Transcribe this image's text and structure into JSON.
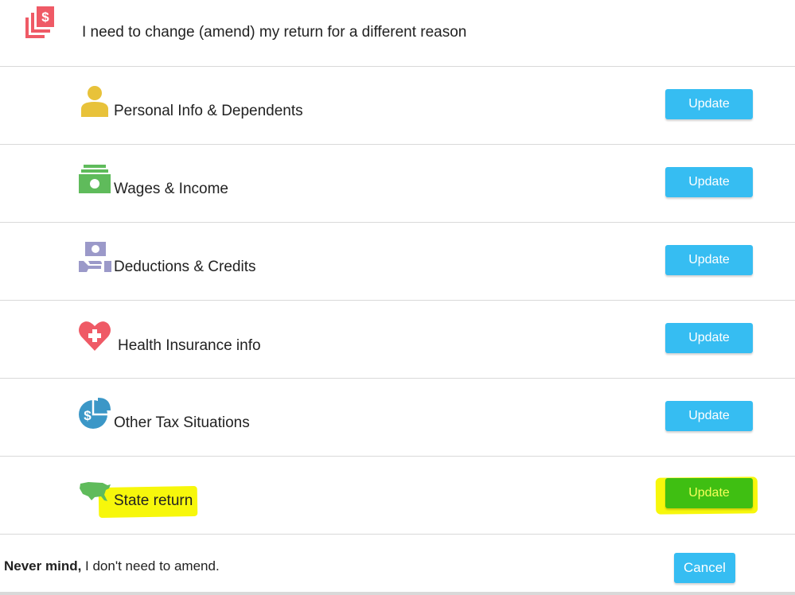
{
  "header": {
    "title": "I need to change (amend) my return for a different reason",
    "icon": "stacked-dollar-bills-icon"
  },
  "rows": [
    {
      "label": "Personal Info & Dependents",
      "button": "Update",
      "icon": "person-icon",
      "icon_color": "#e8c23a"
    },
    {
      "label": "Wages & Income",
      "button": "Update",
      "icon": "cash-icon",
      "icon_color": "#5fbb5b"
    },
    {
      "label": "Deductions & Credits",
      "button": "Update",
      "icon": "hand-money-icon",
      "icon_color": "#9b99c9"
    },
    {
      "label": "Health Insurance info",
      "button": "Update",
      "icon": "heart-plus-icon",
      "icon_color": "#ef5a66"
    },
    {
      "label": "Other Tax Situations",
      "button": "Update",
      "icon": "dollar-pie-icon",
      "icon_color": "#3b97c7"
    },
    {
      "label": "State return",
      "button": "Update",
      "icon": "usa-map-icon",
      "icon_color": "#5fbb5b",
      "highlighted": true
    }
  ],
  "footer": {
    "bold": "Never mind,",
    "text": " I don't need to amend.",
    "cancel": "Cancel"
  },
  "colors": {
    "button": "#36bdf2",
    "highlight": "#f7f70b",
    "highlight_button": "#3fbf12",
    "divider": "#d9d9d9"
  }
}
